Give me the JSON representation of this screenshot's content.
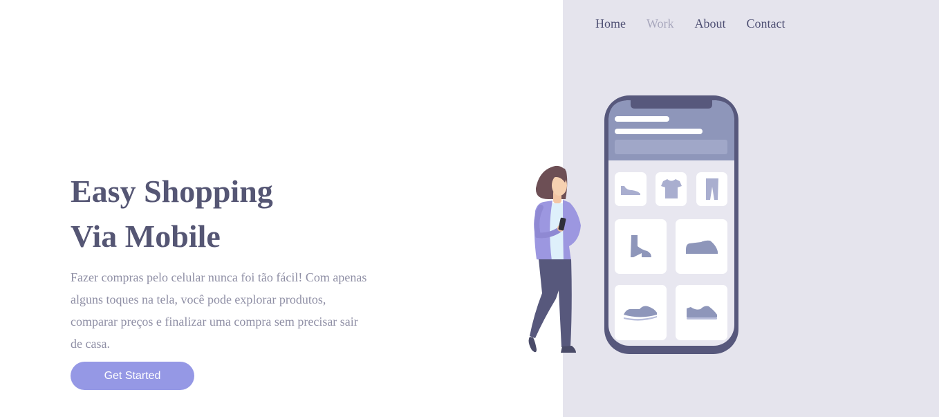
{
  "nav": {
    "items": [
      {
        "label": "Home",
        "active": false
      },
      {
        "label": "Work",
        "active": true
      },
      {
        "label": "About",
        "active": false
      },
      {
        "label": "Contact",
        "active": false
      }
    ]
  },
  "hero": {
    "title_line1": "Easy Shopping",
    "title_line2": "Via Mobile",
    "description": "Fazer compras pelo celular nunca foi tão fácil! Com apenas alguns toques na tela, você pode explorar produtos, comparar preços e finalizar uma compra sem precisar sair de casa.",
    "cta_label": "Get Started"
  },
  "colors": {
    "panel_bg": "#e5e4ed",
    "title": "#555674",
    "body_text": "#8f8fa5",
    "button": "#9598e5",
    "nav_active": "#a7a6bc",
    "phone_frame": "#57587c",
    "phone_header": "#8e96ba",
    "product_icon": "#8e96ba"
  },
  "illustration": {
    "name": "woman-with-phone-and-shopping-app",
    "product_icons": [
      "flat-shoe-icon",
      "tshirt-icon",
      "pants-icon",
      "boot-icon",
      "sneaker-icon",
      "sneaker-icon",
      "sneaker-icon"
    ]
  }
}
